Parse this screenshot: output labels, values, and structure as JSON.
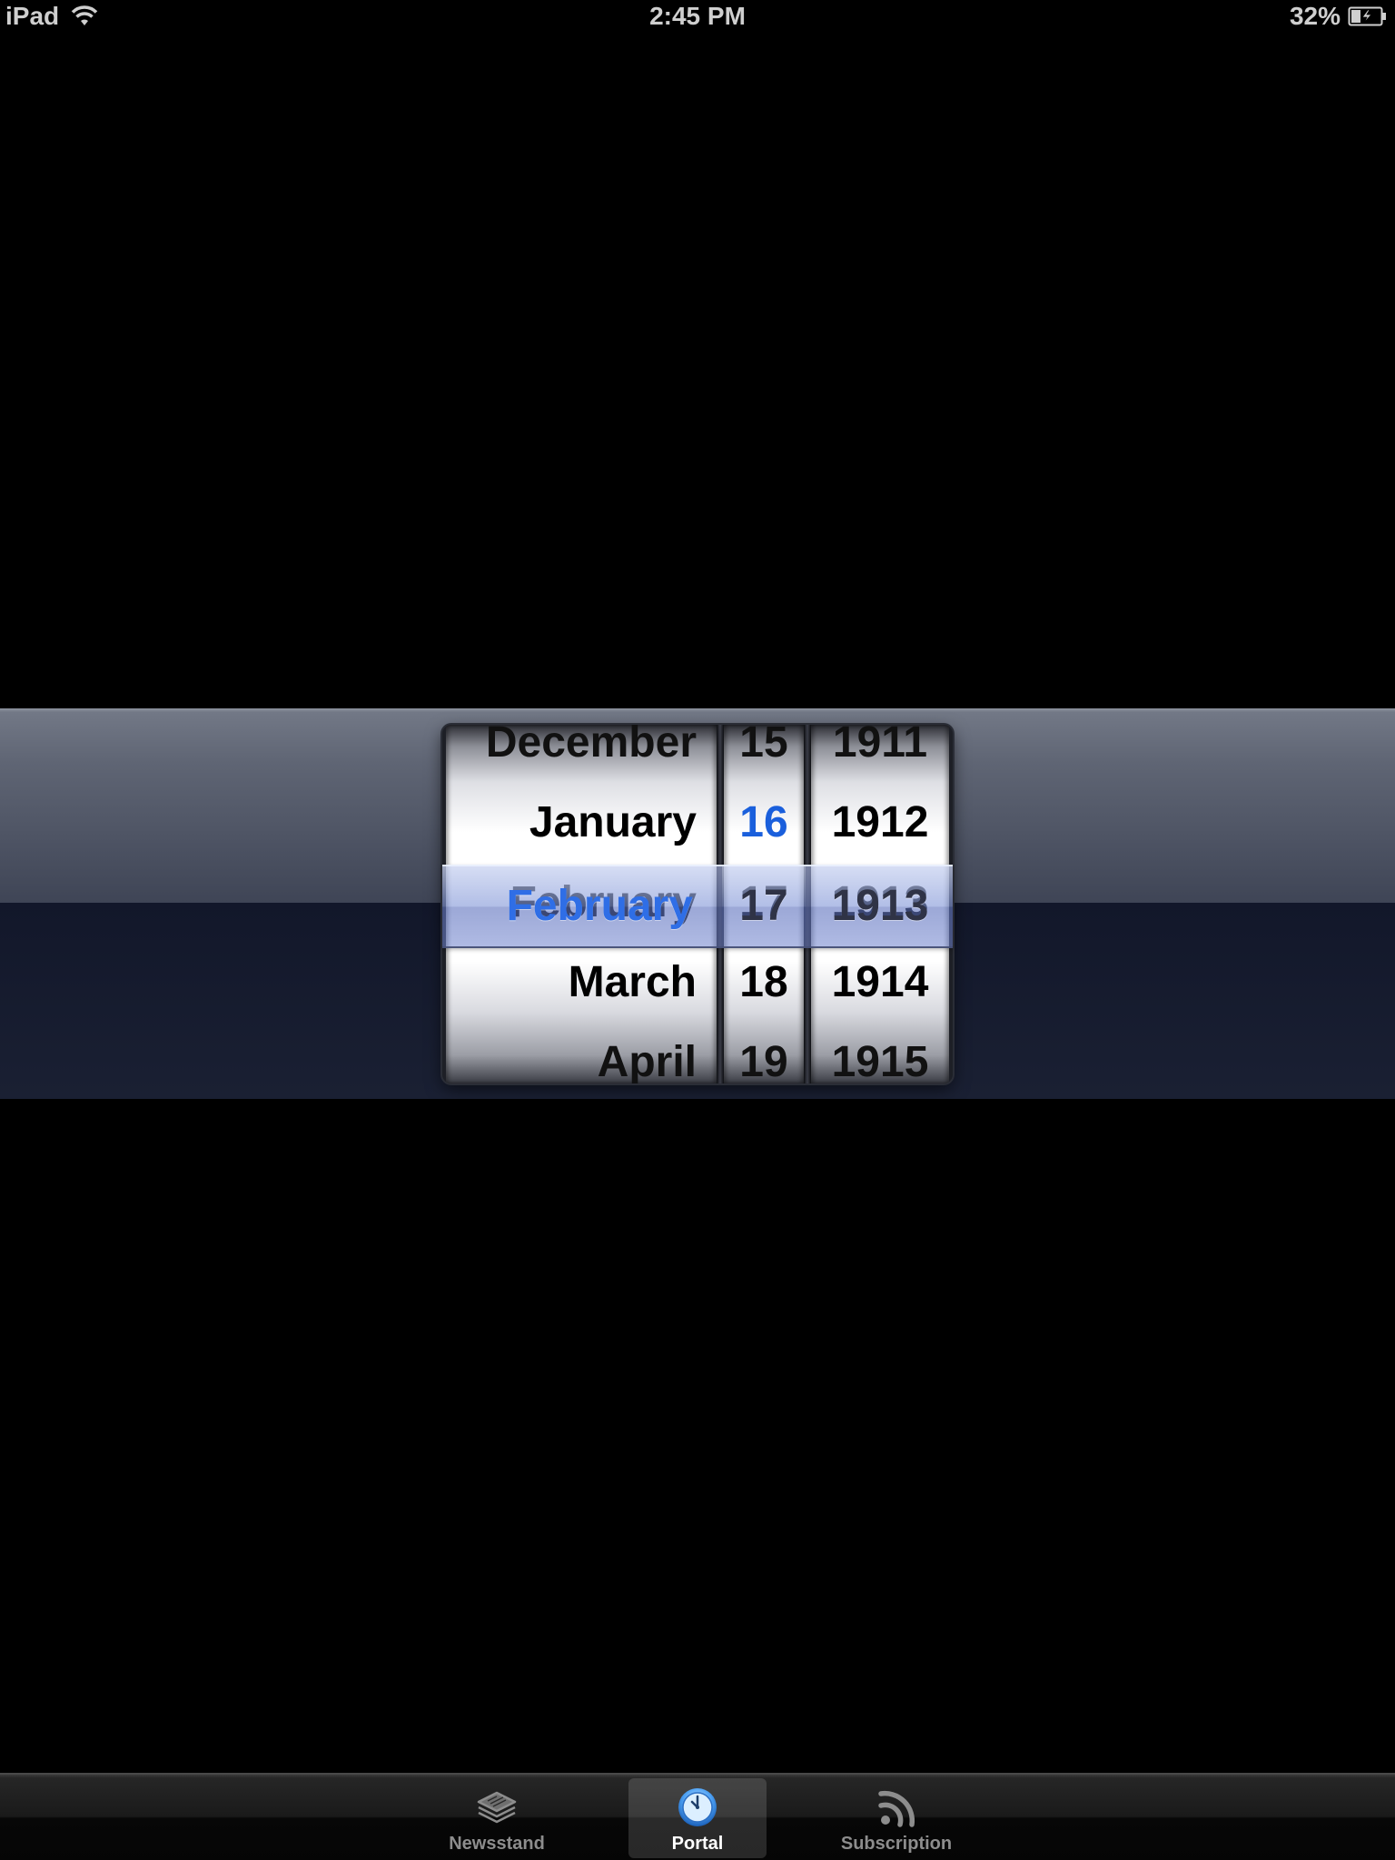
{
  "status_bar": {
    "device": "iPad",
    "time": "2:45 PM",
    "battery": "32%",
    "battery_level": 0.32
  },
  "picker": {
    "months": [
      "December",
      "January",
      "February",
      "March",
      "April"
    ],
    "days": [
      "15",
      "16",
      "17",
      "18",
      "19"
    ],
    "years": [
      "1911",
      "1912",
      "1913",
      "1914",
      "1915"
    ],
    "selected": {
      "month": "February",
      "day": "17",
      "year": "1913"
    },
    "highlight_color": "#1a5fdc",
    "selection_color": "#2f6ee6"
  },
  "tab_bar": {
    "tabs": [
      {
        "label": "Newsstand",
        "icon": "newsstand-icon",
        "active": false
      },
      {
        "label": "Portal",
        "icon": "clock-icon",
        "active": true
      },
      {
        "label": "Subscription",
        "icon": "rss-icon",
        "active": false
      }
    ]
  }
}
